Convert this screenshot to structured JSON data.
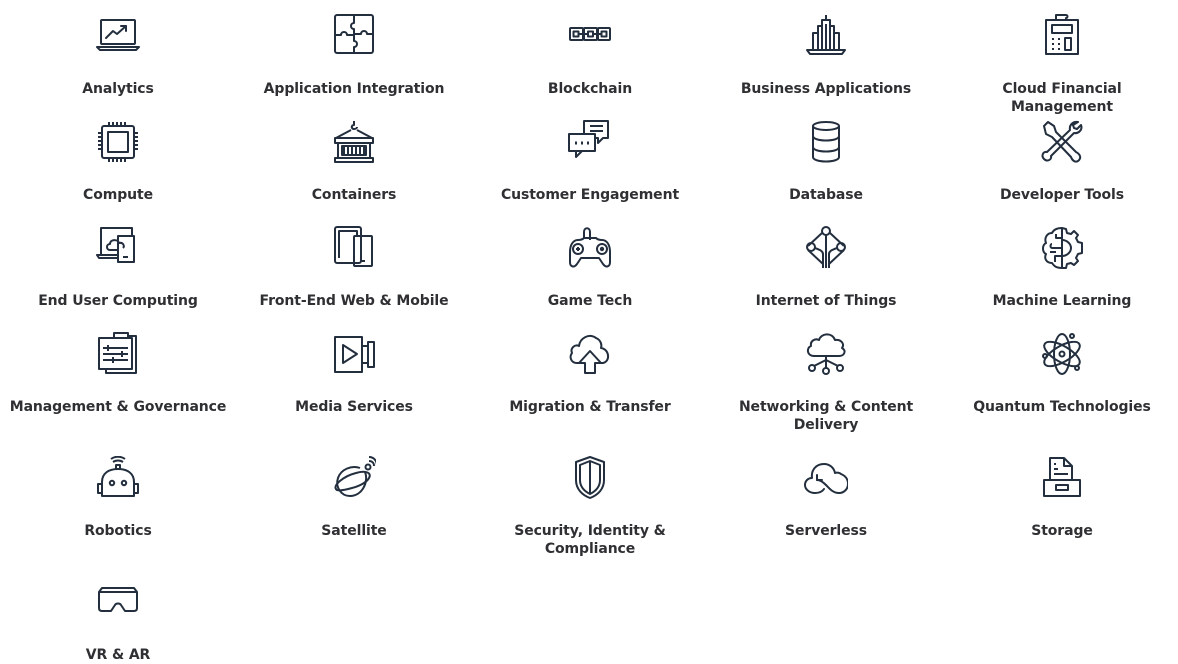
{
  "theme": {
    "icon_color": "#232f3e",
    "label_color": "#2f3033",
    "background": "#ffffff"
  },
  "categories": [
    {
      "label": "Analytics",
      "icon": "analytics-icon"
    },
    {
      "label": "Application Integration",
      "icon": "puzzle-icon"
    },
    {
      "label": "Blockchain",
      "icon": "blockchain-icon"
    },
    {
      "label": "Business Applications",
      "icon": "building-icon"
    },
    {
      "label": "Cloud Financial Management",
      "icon": "calculator-icon"
    },
    {
      "label": "Compute",
      "icon": "chip-icon"
    },
    {
      "label": "Containers",
      "icon": "container-icon"
    },
    {
      "label": "Customer Engagement",
      "icon": "chat-bubbles-icon"
    },
    {
      "label": "Database",
      "icon": "database-icon"
    },
    {
      "label": "Developer Tools",
      "icon": "tools-icon"
    },
    {
      "label": "End User Computing",
      "icon": "desktop-cloud-icon"
    },
    {
      "label": "Front-End Web & Mobile",
      "icon": "devices-icon"
    },
    {
      "label": "Game Tech",
      "icon": "gamepad-icon"
    },
    {
      "label": "Internet of Things",
      "icon": "iot-icon"
    },
    {
      "label": "Machine Learning",
      "icon": "brain-gear-icon"
    },
    {
      "label": "Management & Governance",
      "icon": "clipboard-icon"
    },
    {
      "label": "Media Services",
      "icon": "video-camera-icon"
    },
    {
      "label": "Migration & Transfer",
      "icon": "cloud-upload-icon"
    },
    {
      "label": "Networking & Content Delivery",
      "icon": "cloud-network-icon"
    },
    {
      "label": "Quantum Technologies",
      "icon": "atom-icon"
    },
    {
      "label": "Robotics",
      "icon": "robot-icon"
    },
    {
      "label": "Satellite",
      "icon": "satellite-icon"
    },
    {
      "label": "Security, Identity & Compliance",
      "icon": "shield-icon"
    },
    {
      "label": "Serverless",
      "icon": "cloud-serverless-icon"
    },
    {
      "label": "Storage",
      "icon": "storage-icon"
    },
    {
      "label": "VR & AR",
      "icon": "vr-headset-icon"
    }
  ]
}
